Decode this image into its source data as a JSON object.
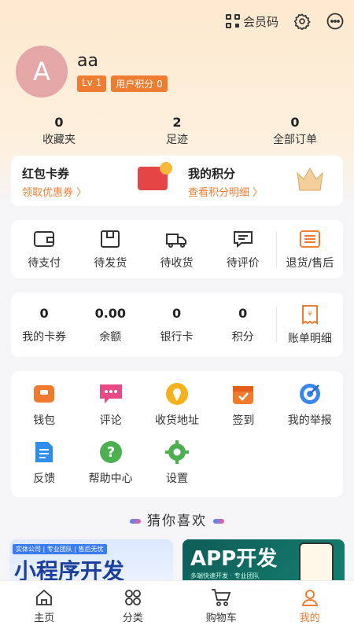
{
  "header": {
    "member_code_label": "会员码"
  },
  "profile": {
    "avatar_letter": "A",
    "username": "aa",
    "level": "Lv 1",
    "points_badge": "用户积分 0"
  },
  "stats": [
    {
      "value": "0",
      "label": "收藏夹"
    },
    {
      "value": "2",
      "label": "足迹"
    },
    {
      "value": "0",
      "label": "全部订单"
    }
  ],
  "promo": {
    "coupon_title": "红包卡券",
    "coupon_sub": "领取优惠券 〉",
    "points_title": "我的积分",
    "points_sub": "查看积分明细 〉"
  },
  "orders": [
    {
      "label": "待支付",
      "icon": "wallet-icon"
    },
    {
      "label": "待发货",
      "icon": "box-icon"
    },
    {
      "label": "待收货",
      "icon": "truck-icon"
    },
    {
      "label": "待评价",
      "icon": "comment-icon"
    },
    {
      "label": "退货/售后",
      "icon": "return-icon"
    }
  ],
  "wallet": [
    {
      "value": "0",
      "label": "我的卡券"
    },
    {
      "value": "0.00",
      "label": "余额"
    },
    {
      "value": "0",
      "label": "银行卡"
    },
    {
      "value": "0",
      "label": "积分"
    }
  ],
  "bill_label": "账单明细",
  "tools": [
    {
      "label": "钱包",
      "icon": "purse-icon"
    },
    {
      "label": "评论",
      "icon": "chat-icon"
    },
    {
      "label": "收货地址",
      "icon": "location-icon"
    },
    {
      "label": "签到",
      "icon": "calendar-icon"
    },
    {
      "label": "我的举报",
      "icon": "target-icon"
    },
    {
      "label": "反馈",
      "icon": "feedback-icon"
    },
    {
      "label": "帮助中心",
      "icon": "help-icon"
    },
    {
      "label": "设置",
      "icon": "settings-icon"
    }
  ],
  "recommend_title": "猜你喜欢",
  "banners": {
    "b1_tag": "实体公司 | 专业团队 | 售后无忧",
    "b1_text": "小程序开发",
    "b2_text": "APP开发",
    "b2_sub": "多端快速开发 · 专业团队"
  },
  "tabs": [
    {
      "label": "主页",
      "icon": "home-icon"
    },
    {
      "label": "分类",
      "icon": "category-icon"
    },
    {
      "label": "购物车",
      "icon": "cart-icon"
    },
    {
      "label": "我的",
      "icon": "user-icon"
    }
  ],
  "colors": {
    "accent": "#ee7d32",
    "active_tab": "#ee7d32"
  }
}
